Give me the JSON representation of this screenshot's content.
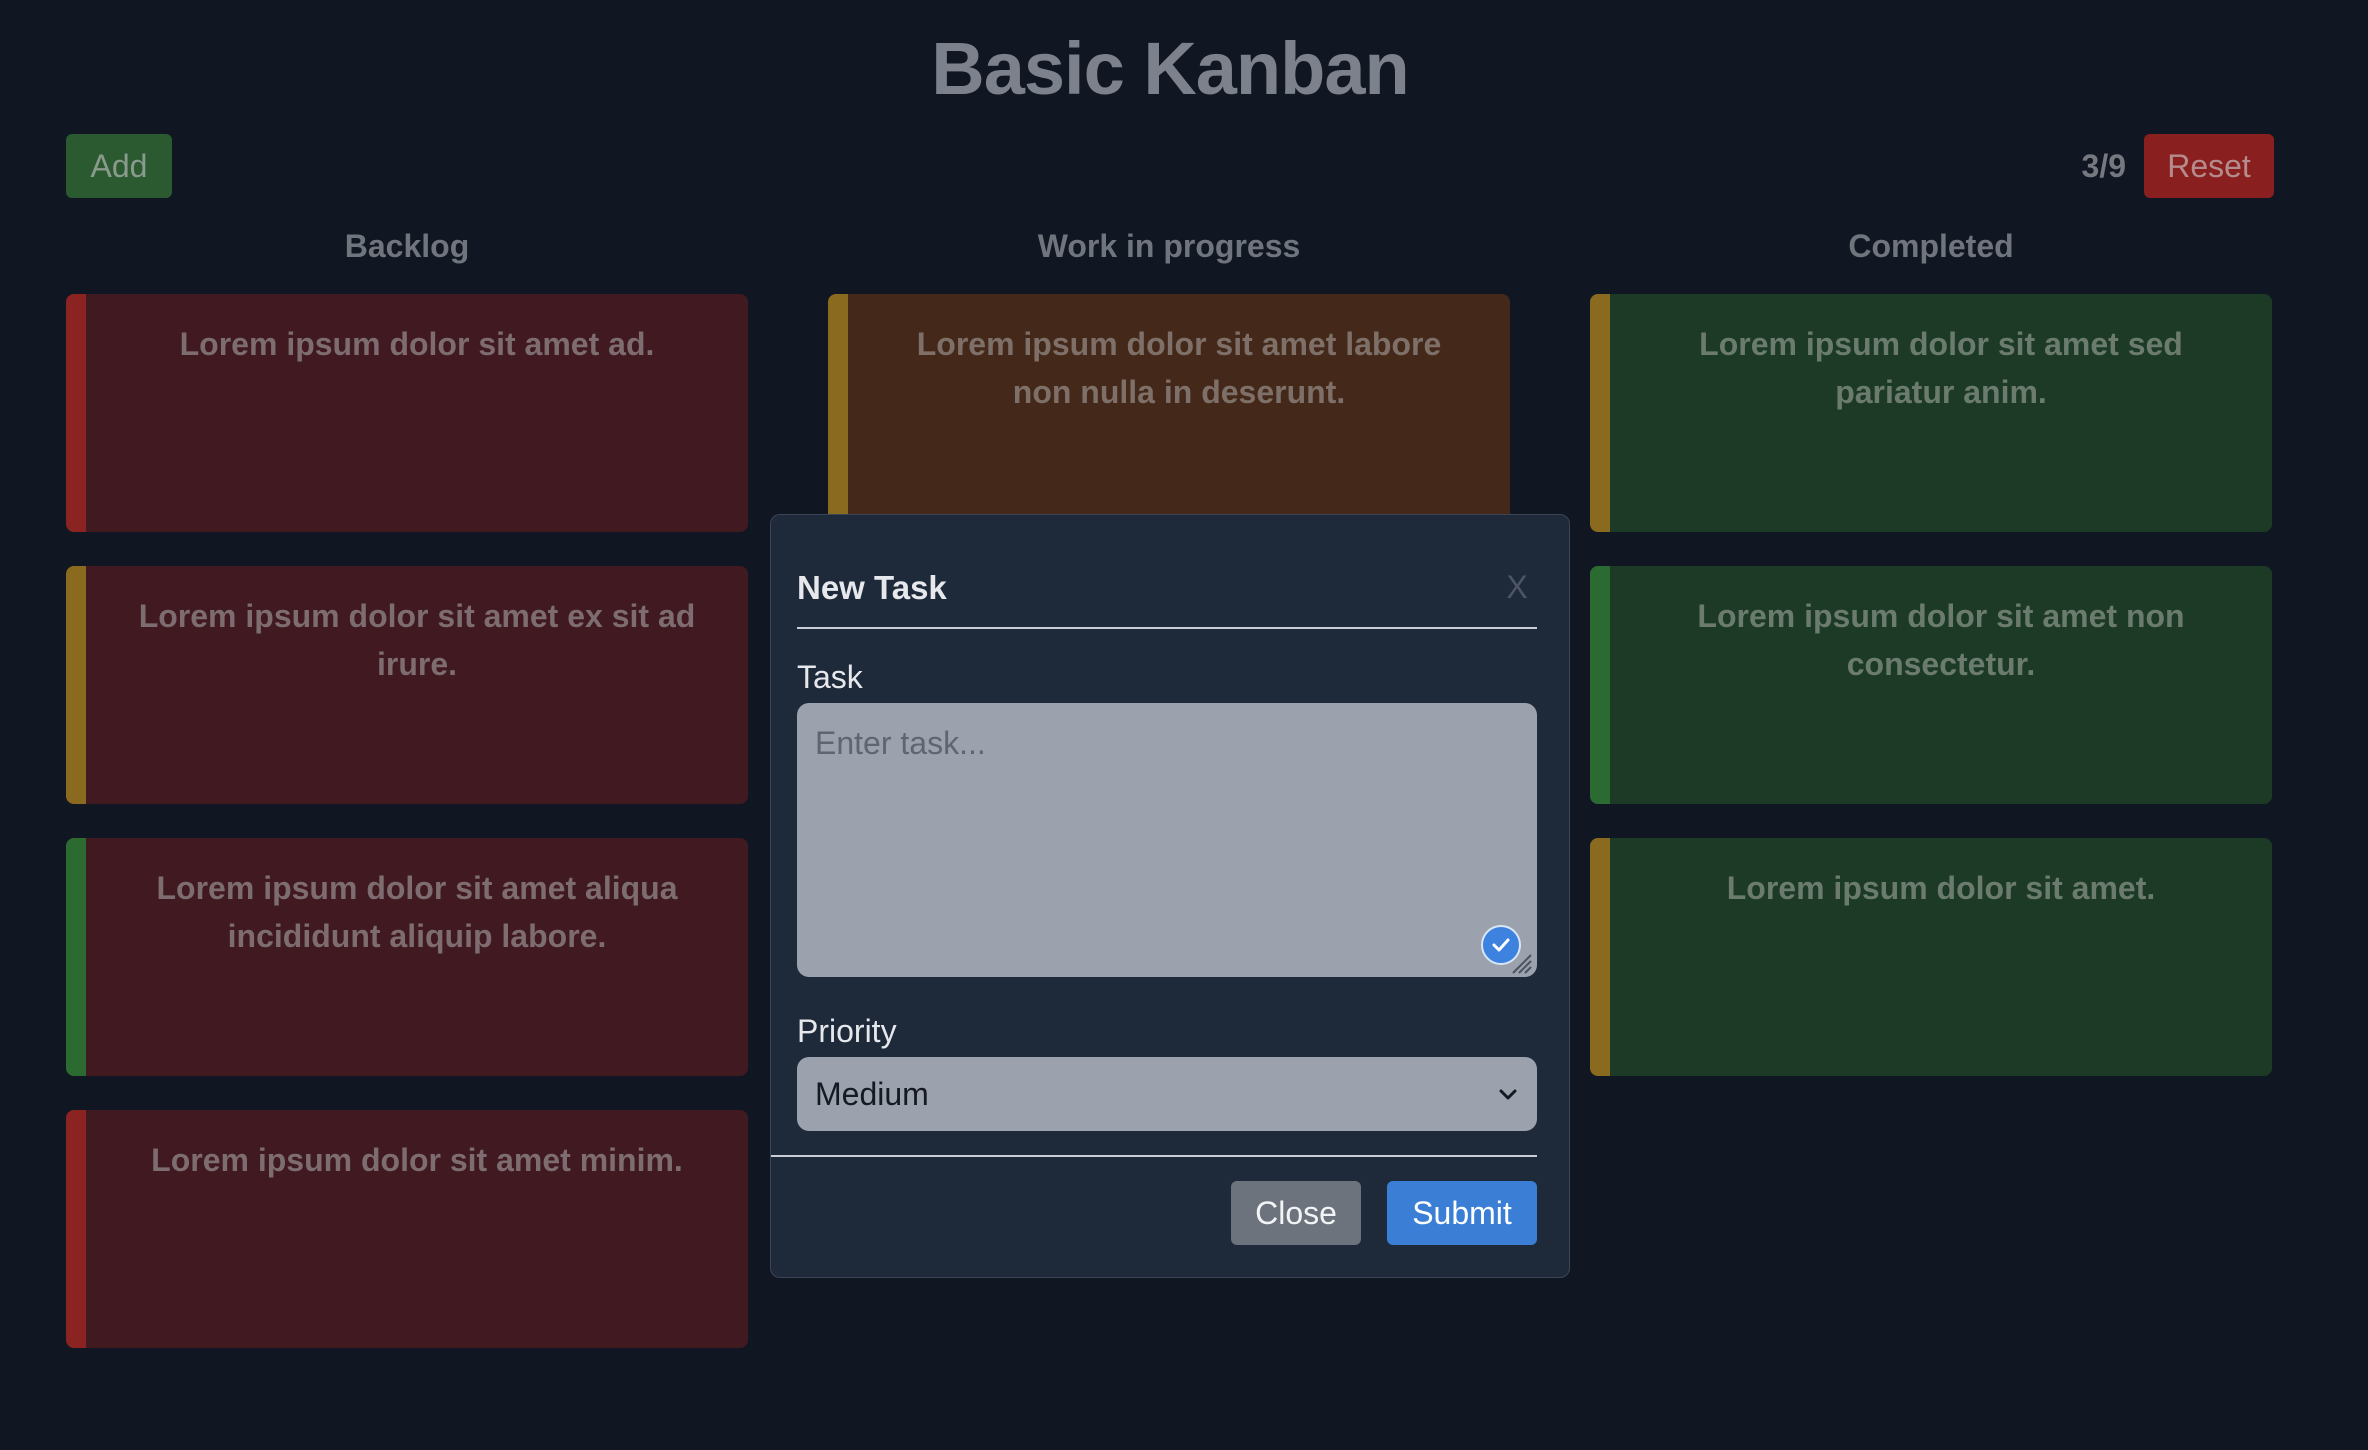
{
  "page": {
    "title": "Basic Kanban"
  },
  "toolbar": {
    "add_label": "Add",
    "counter": "3/9",
    "reset_label": "Reset"
  },
  "columns": [
    {
      "title": "Backlog",
      "cards": [
        {
          "text": "Lorem ipsum dolor sit amet ad.",
          "priority_color": "#8b2323"
        },
        {
          "text": "Lorem ipsum dolor sit amet ex sit ad irure.",
          "priority_color": "#8a6a1e"
        },
        {
          "text": "Lorem ipsum dolor sit amet aliqua incididunt aliquip labore.",
          "priority_color": "#2b6b32"
        },
        {
          "text": "Lorem ipsum dolor sit amet minim.",
          "priority_color": "#8b2323"
        }
      ]
    },
    {
      "title": "Work in progress",
      "cards": [
        {
          "text": "Lorem ipsum dolor sit amet labore non nulla in deserunt.",
          "priority_color": "#8a6a1e"
        }
      ]
    },
    {
      "title": "Completed",
      "cards": [
        {
          "text": "Lorem ipsum dolor sit amet sed pariatur anim.",
          "priority_color": "#8a6a1e"
        },
        {
          "text": "Lorem ipsum dolor sit amet non consectetur.",
          "priority_color": "#2b6b32"
        },
        {
          "text": "Lorem ipsum dolor sit amet.",
          "priority_color": "#8a6a1e"
        }
      ]
    }
  ],
  "modal": {
    "title": "New Task",
    "close_glyph": "X",
    "task_label": "Task",
    "task_placeholder": "Enter task...",
    "task_value": "",
    "priority_label": "Priority",
    "priority_value": "Medium",
    "close_button": "Close",
    "submit_button": "Submit"
  },
  "icons": {
    "field_status": "checkmark-icon",
    "select_arrow": "chevron-down-icon",
    "resize": "resize-grip-icon"
  },
  "colors": {
    "background": "#111722",
    "add_button": "#2b5a31",
    "reset_button": "#8a1f1f",
    "submit_button": "#3a7fd5",
    "close_button": "#6d737d",
    "modal_background": "#1e293a"
  }
}
